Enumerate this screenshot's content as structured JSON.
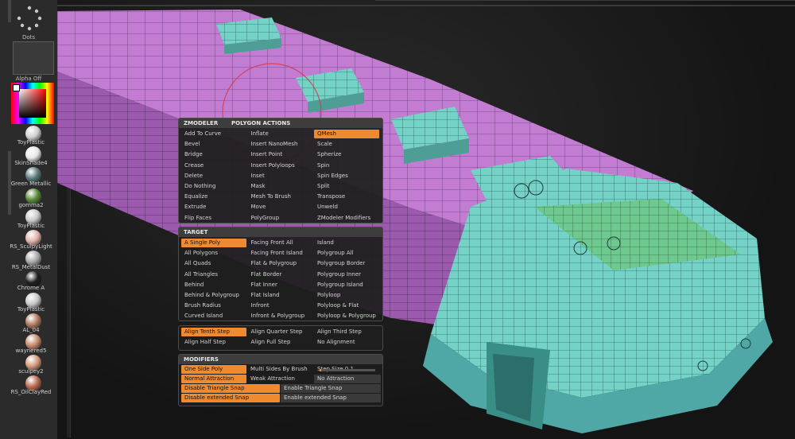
{
  "sidebar": {
    "dots_label": "Dots",
    "alpha_label": "Alpha Off",
    "materials": [
      {
        "label": "ToyPlastic",
        "color": "#cfcfcf"
      },
      {
        "label": "SkinShade4",
        "color": "#e8e8e8"
      },
      {
        "label": "Green Metallic",
        "color": "#5a7a7a"
      },
      {
        "label": "gomma2",
        "color": "#5a8a3a"
      },
      {
        "label": "ToyPlastic",
        "color": "#c8c8c8"
      },
      {
        "label": "RS_SculpyLight",
        "color": "#e0b4aa"
      },
      {
        "label": "RS_MetalDust",
        "color": "#a8a8a8"
      },
      {
        "label": "Chrome A",
        "color": "#202020"
      },
      {
        "label": "ToyPlastic",
        "color": "#c8c8c8"
      },
      {
        "label": "AL_04",
        "color": "#b07a60"
      },
      {
        "label": "waynered5",
        "color": "#c88a70"
      },
      {
        "label": "sculpey2",
        "color": "#d49a7a"
      },
      {
        "label": "RS_OilClayRed",
        "color": "#b86a50"
      }
    ]
  },
  "zmodeler": {
    "header": "ZMODELER",
    "subheader": "POLYGON ACTIONS",
    "columns": [
      [
        "Add To Curve",
        "Bevel",
        "Bridge",
        "Crease",
        "Delete",
        "Do Nothing",
        "Equalize",
        "Extrude",
        "Flip Faces"
      ],
      [
        "Inflate",
        "Insert NanoMesh",
        "Insert Point",
        "Insert Polyloops",
        "Inset",
        "Mask",
        "Mesh To Brush",
        "Move",
        "PolyGroup"
      ],
      [
        "QMesh",
        "Scale",
        "Spherize",
        "Spin",
        "Spin Edges",
        "Split",
        "Transpose",
        "Unweld",
        "ZModeler Modifiers"
      ]
    ],
    "selected": "QMesh"
  },
  "target": {
    "header": "TARGET",
    "columns": [
      [
        "A Single Poly",
        "All Polygons",
        "All Quads",
        "All Triangles",
        "Behind",
        "Behind & Polygroup",
        "Brush Radius",
        "Curved Island"
      ],
      [
        "Facing Front All",
        "Facing Front Island",
        "Flat & Polygroup",
        "Flat Border",
        "Flat Inner",
        "Flat Island",
        "Infront",
        "Infront & Polygroup"
      ],
      [
        "Island",
        "Polygroup All",
        "Polygroup Border",
        "Polygroup Inner",
        "Polygroup Island",
        "Polyloop",
        "Polyloop & Flat",
        "Polyloop & Polygroup"
      ]
    ],
    "selected": "A Single Poly"
  },
  "steps": {
    "row1": [
      "Align Tenth Step",
      "Align Quarter Step",
      "Align Third Step"
    ],
    "row2": [
      "Align Half Step",
      "Align Full Step",
      "No Alignment"
    ],
    "selected": "Align Tenth Step"
  },
  "modifiers": {
    "header": "MODIFIERS",
    "row1": [
      "One Side Poly",
      "Multi Sides By Brush"
    ],
    "step_size_label": "Step Size",
    "step_size_value": "0.1",
    "row2": [
      "Normal Attraction",
      "Weak Attraction",
      "No Attraction"
    ],
    "row3": [
      "Disable Triangle Snap",
      "Enable Triangle Snap"
    ],
    "row4": [
      "Disable extended Snap",
      "Enable extended Snap"
    ]
  },
  "colors": {
    "accent": "#f08a2e",
    "mesh_pink": "#c07ad0",
    "mesh_teal": "#72d0c4",
    "mesh_green": "#6cc48a"
  }
}
